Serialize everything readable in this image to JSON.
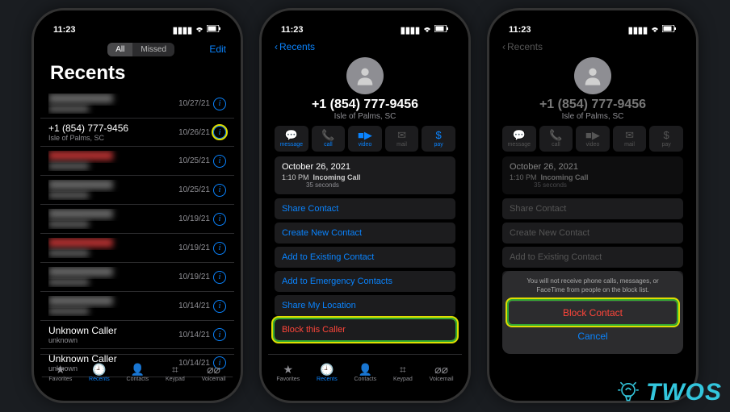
{
  "status": {
    "time": "11:23",
    "time2": "11:23",
    "time3": "11:23"
  },
  "phone1": {
    "seg_all": "All",
    "seg_missed": "Missed",
    "edit": "Edit",
    "title": "Recents",
    "calls": [
      {
        "name": "",
        "sub": "",
        "date": "10/27/21",
        "blur": true
      },
      {
        "name": "+1 (854) 777-9456",
        "sub": "Isle of Palms, SC",
        "date": "10/26/21",
        "hl": true
      },
      {
        "name": "",
        "sub": "",
        "date": "10/25/21",
        "blur": true,
        "red": true
      },
      {
        "name": "",
        "sub": "",
        "date": "10/25/21",
        "blur": true
      },
      {
        "name": "",
        "sub": "",
        "date": "10/19/21",
        "blur": true
      },
      {
        "name": "",
        "sub": "",
        "date": "10/19/21",
        "blur": true,
        "red": true
      },
      {
        "name": "",
        "sub": "",
        "date": "10/19/21",
        "blur": true
      },
      {
        "name": "",
        "sub": "",
        "date": "10/14/21",
        "blur": true
      },
      {
        "name": "Unknown Caller",
        "sub": "unknown",
        "date": "10/14/21"
      },
      {
        "name": "Unknown Caller",
        "sub": "unknown",
        "date": "10/14/21"
      }
    ]
  },
  "tabs": {
    "favorites": "Favorites",
    "recents": "Recents",
    "contacts": "Contacts",
    "keypad": "Keypad",
    "voicemail": "Voicemail"
  },
  "detail": {
    "back": "Recents",
    "number": "+1 (854) 777-9456",
    "loc": "Isle of Palms, SC",
    "actions": {
      "message": "message",
      "call": "call",
      "video": "video",
      "mail": "mail",
      "pay": "pay"
    },
    "card_date": "October 26, 2021",
    "card_time": "1:10 PM",
    "card_type": "Incoming Call",
    "card_dur": "35 seconds",
    "opt_share": "Share Contact",
    "opt_create": "Create New Contact",
    "opt_add_existing": "Add to Existing Contact",
    "opt_emergency": "Add to Emergency Contacts",
    "opt_share_loc": "Share My Location",
    "opt_block": "Block this Caller"
  },
  "modal": {
    "msg": "You will not receive phone calls, messages, or FaceTime from people on the block list.",
    "block": "Block Contact",
    "cancel": "Cancel"
  },
  "logo_text": "TWOS"
}
